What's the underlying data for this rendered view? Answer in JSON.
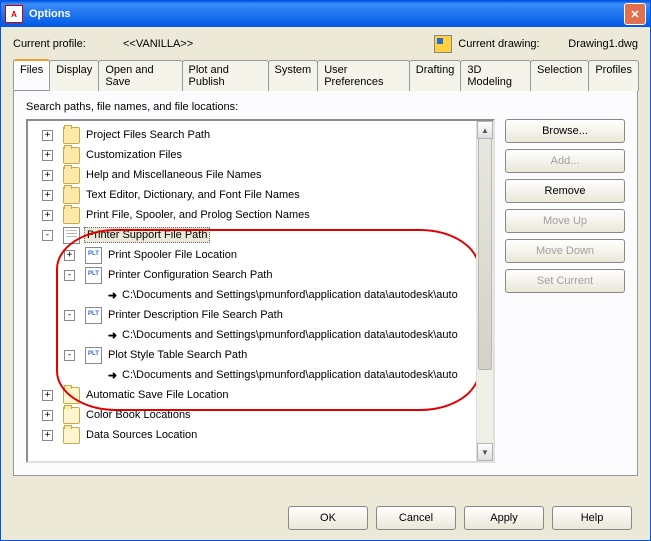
{
  "window": {
    "title": "Options"
  },
  "profile": {
    "label": "Current profile:",
    "value": "<<VANILLA>>",
    "drawing_label": "Current drawing:",
    "drawing_value": "Drawing1.dwg"
  },
  "tabs": [
    "Files",
    "Display",
    "Open and Save",
    "Plot and Publish",
    "System",
    "User Preferences",
    "Drafting",
    "3D Modeling",
    "Selection",
    "Profiles"
  ],
  "active_tab": 0,
  "panel": {
    "caption": "Search paths, file names, and file locations:"
  },
  "tree": [
    {
      "depth": 0,
      "toggle": "+",
      "icon": "folder",
      "label": "Project Files Search Path"
    },
    {
      "depth": 0,
      "toggle": "+",
      "icon": "folder",
      "label": "Customization Files"
    },
    {
      "depth": 0,
      "toggle": "+",
      "icon": "folder",
      "label": "Help and Miscellaneous File Names"
    },
    {
      "depth": 0,
      "toggle": "+",
      "icon": "folder",
      "label": "Text Editor, Dictionary, and Font File Names"
    },
    {
      "depth": 0,
      "toggle": "+",
      "icon": "folder",
      "label": "Print File, Spooler, and Prolog Section Names"
    },
    {
      "depth": 0,
      "toggle": "-",
      "icon": "paper",
      "label": "Printer Support File Path",
      "highlight": true
    },
    {
      "depth": 1,
      "toggle": "+",
      "icon": "plt",
      "label": "Print Spooler File Location"
    },
    {
      "depth": 1,
      "toggle": "-",
      "icon": "plt",
      "label": "Printer Configuration Search Path"
    },
    {
      "depth": 2,
      "toggle": "",
      "icon": "arrow",
      "label": "C:\\Documents and Settings\\pmunford\\application data\\autodesk\\auto"
    },
    {
      "depth": 1,
      "toggle": "-",
      "icon": "plt",
      "label": "Printer Description File Search Path"
    },
    {
      "depth": 2,
      "toggle": "",
      "icon": "arrow",
      "label": "C:\\Documents and Settings\\pmunford\\application data\\autodesk\\auto"
    },
    {
      "depth": 1,
      "toggle": "-",
      "icon": "plt",
      "label": "Plot Style Table Search Path"
    },
    {
      "depth": 2,
      "toggle": "",
      "icon": "arrow",
      "label": "C:\\Documents and Settings\\pmunford\\application data\\autodesk\\auto"
    },
    {
      "depth": 0,
      "toggle": "+",
      "icon": "folder-open",
      "label": "Automatic Save File Location"
    },
    {
      "depth": 0,
      "toggle": "+",
      "icon": "folder-open",
      "label": "Color Book Locations"
    },
    {
      "depth": 0,
      "toggle": "+",
      "icon": "folder-open",
      "label": "Data Sources Location"
    }
  ],
  "buttons": {
    "browse": "Browse...",
    "add": "Add...",
    "remove": "Remove",
    "moveup": "Move Up",
    "movedown": "Move Down",
    "setcurrent": "Set Current"
  },
  "bottom": {
    "ok": "OK",
    "cancel": "Cancel",
    "apply": "Apply",
    "help": "Help"
  }
}
